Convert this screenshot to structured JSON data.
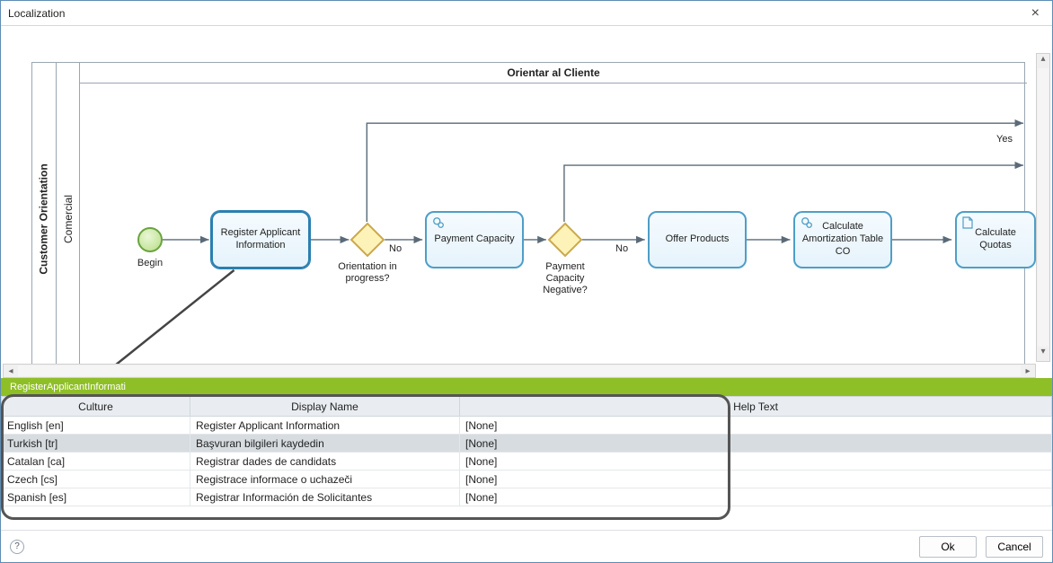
{
  "window": {
    "title": "Localization"
  },
  "diagram": {
    "pool_label": "Customer Orientation",
    "lane_label": "Comercial",
    "lane_title": "Orientar al Cliente",
    "nodes": {
      "begin": {
        "label": "Begin"
      },
      "register": {
        "label": "Register Applicant Information"
      },
      "gw1_label": "Orientation in progress?",
      "payment": {
        "label": "Payment Capacity"
      },
      "gw1_no": "No",
      "gw2_label": "Payment Capacity Negative?",
      "gw2_no": "No",
      "gw2_yes": "Yes",
      "offer": {
        "label": "Offer Products"
      },
      "amort": {
        "label": "Calculate Amortization Table CO"
      },
      "quotas": {
        "label": "Calculate Quotas"
      }
    }
  },
  "tab": {
    "label": "RegisterApplicantInformati"
  },
  "grid": {
    "headers": {
      "culture": "Culture",
      "display": "Display Name",
      "help": "Help Text"
    },
    "rows": [
      {
        "culture": "English [en]",
        "display": "Register Applicant Information",
        "help": "[None]",
        "selected": false
      },
      {
        "culture": "Turkish [tr]",
        "display": "Başvuran bilgileri kaydedin",
        "help": "[None]",
        "selected": true
      },
      {
        "culture": "Catalan [ca]",
        "display": "Registrar dades de candidats",
        "help": "[None]",
        "selected": false
      },
      {
        "culture": "Czech [cs]",
        "display": "Registrace informace o uchazeči",
        "help": "[None]",
        "selected": false
      },
      {
        "culture": "Spanish [es]",
        "display": "Registrar Información de Solicitantes",
        "help": "[None]",
        "selected": false
      }
    ]
  },
  "footer": {
    "ok": "Ok",
    "cancel": "Cancel"
  }
}
